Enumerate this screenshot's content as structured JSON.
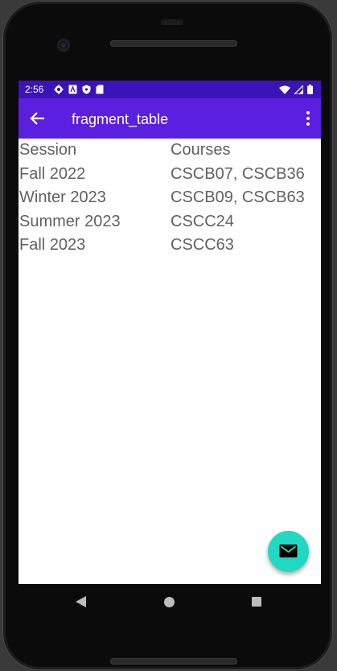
{
  "status_bar": {
    "time": "2:56",
    "left_icons": [
      "gear-icon",
      "a-icon",
      "shield-icon",
      "sd-card-icon"
    ],
    "right_icons": [
      "wifi-icon",
      "signal-icon",
      "battery-icon"
    ]
  },
  "app_bar": {
    "title": "fragment_table",
    "back_icon": "arrow-left-icon",
    "menu_icon": "more-vert-icon"
  },
  "table": {
    "headers": [
      "Session",
      "Courses"
    ],
    "rows": [
      [
        "Fall 2022",
        "CSCB07, CSCB36"
      ],
      [
        "Winter 2023",
        "CSCB09, CSCB63"
      ],
      [
        "Summer 2023",
        "CSCC24"
      ],
      [
        "Fall 2023",
        "CSCC63"
      ]
    ]
  },
  "fab": {
    "icon": "mail-icon",
    "color": "#20d9c2"
  },
  "nav_bar": {
    "icons": [
      "back-triangle-icon",
      "home-circle-icon",
      "recents-square-icon"
    ]
  },
  "colors": {
    "status_bar": "#3c13b8",
    "app_bar": "#5b1fe0",
    "text": "#616161"
  }
}
